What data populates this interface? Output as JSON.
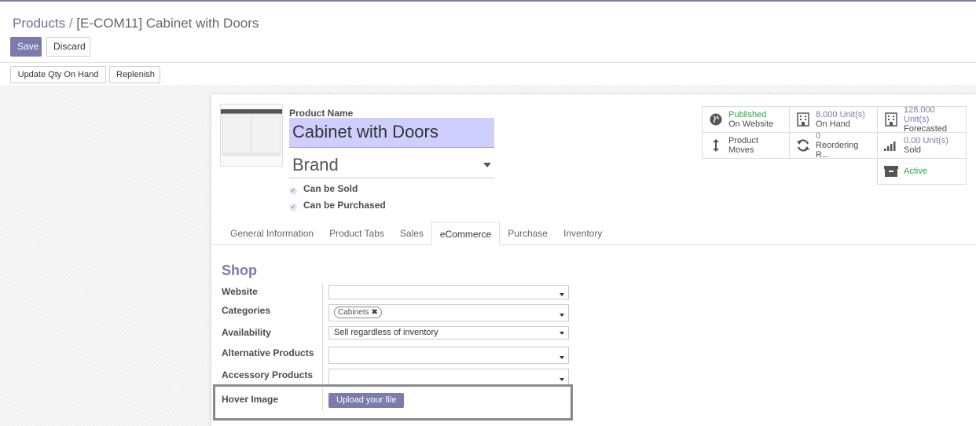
{
  "breadcrumb": {
    "parent": "Products",
    "separator": "/",
    "current": "[E-COM11] Cabinet with Doors"
  },
  "buttons": {
    "save": "Save",
    "discard": "Discard",
    "update_qty": "Update Qty On Hand",
    "replenish": "Replenish"
  },
  "product": {
    "name_label": "Product Name",
    "name": "Cabinet with Doors",
    "brand_placeholder": "Brand",
    "can_be_sold": "Can be Sold",
    "can_be_purchased": "Can be Purchased"
  },
  "stats": {
    "published_line1": "Published",
    "published_line2": "On Website",
    "on_hand_value": "8.000 Unit(s)",
    "on_hand_label": "On Hand",
    "forecasted_value": "128.000 Unit(s)",
    "forecasted_label": "Forecasted",
    "product_moves": "Product Moves",
    "reordering_value": "0",
    "reordering_label": "Reordering R...",
    "sold_value": "0.00 Unit(s)",
    "sold_label": "Sold",
    "active": "Active"
  },
  "tabs": [
    "General Information",
    "Product Tabs",
    "Sales",
    "eCommerce",
    "Purchase",
    "Inventory"
  ],
  "active_tab": "eCommerce",
  "shop": {
    "title": "Shop",
    "website_label": "Website",
    "website_value": "",
    "categories_label": "Categories",
    "category_tag": "Cabinets",
    "availability_label": "Availability",
    "availability_value": "Sell regardless of inventory",
    "alternative_label": "Alternative Products",
    "accessory_label": "Accessory Products",
    "hover_image_label": "Hover Image",
    "upload_label": "Upload your file"
  },
  "icons": {
    "published": "globe-icon",
    "on_hand": "building-icon",
    "forecasted": "building-icon",
    "moves": "arrows-v-icon",
    "reordering": "refresh-icon",
    "sold": "signal-icon",
    "active": "archive-icon"
  },
  "colors": {
    "accent": "#7c7bad",
    "published": "#28a745",
    "active": "#28a745"
  }
}
